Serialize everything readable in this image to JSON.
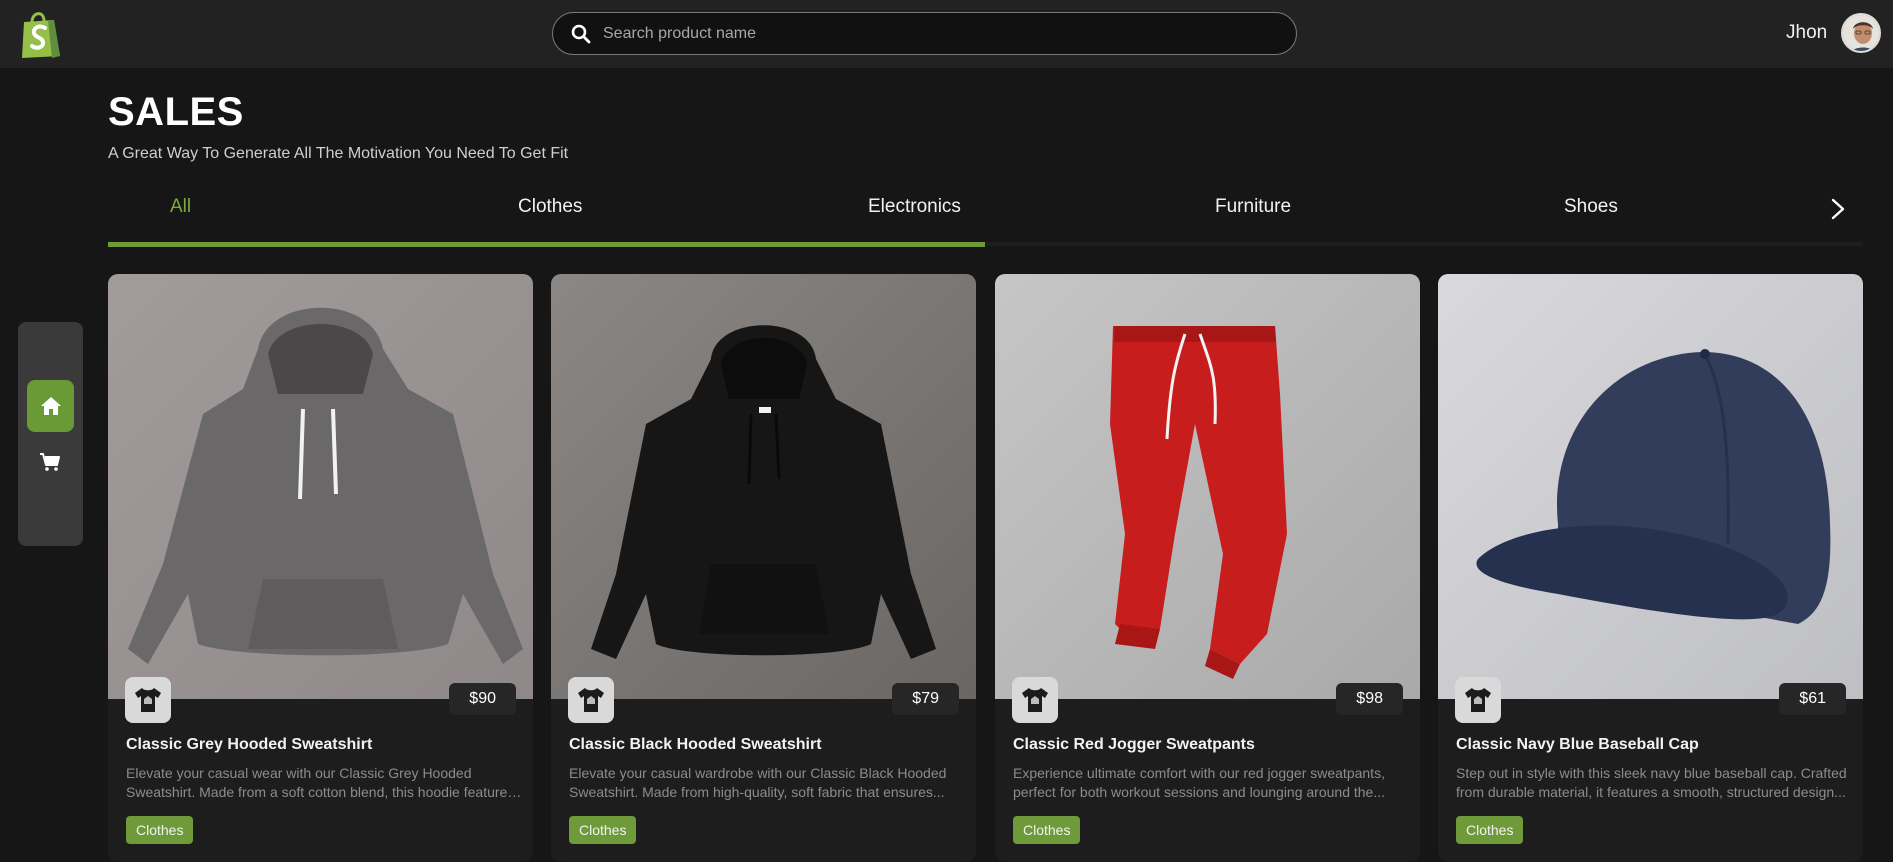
{
  "header": {
    "logo_icon": "shopping-bag-logo-icon",
    "search": {
      "placeholder": "Search product name",
      "value": ""
    },
    "user": {
      "name": "Jhon"
    }
  },
  "page": {
    "title": "SALES",
    "subtitle": "A Great Way To Generate All The Motivation You Need To Get Fit"
  },
  "tabs": [
    {
      "label": "All",
      "active": true
    },
    {
      "label": "Clothes",
      "active": false
    },
    {
      "label": "Electronics",
      "active": false
    },
    {
      "label": "Furniture",
      "active": false
    },
    {
      "label": "Shoes",
      "active": false
    }
  ],
  "sidenav": {
    "items": [
      {
        "icon": "home-icon",
        "active": true
      },
      {
        "icon": "cart-icon",
        "active": false
      }
    ]
  },
  "colors": {
    "accent": "#6e9a3a",
    "accent_text": "#7ea844",
    "background": "#161616",
    "card": "#1d1d1d"
  },
  "products": [
    {
      "title": "Classic Grey Hooded Sweatshirt",
      "price": "$90",
      "description": "Elevate your casual wear with our Classic Grey Hooded Sweatshirt. Made from a soft cotton blend, this hoodie features ...",
      "category": "Clothes"
    },
    {
      "title": "Classic Black Hooded Sweatshirt",
      "price": "$79",
      "description": "Elevate your casual wardrobe with our Classic Black Hooded Sweatshirt. Made from high-quality, soft fabric that ensures...",
      "category": "Clothes"
    },
    {
      "title": "Classic Red Jogger Sweatpants",
      "price": "$98",
      "description": "Experience ultimate comfort with our red jogger sweatpants, perfect for both workout sessions and lounging around the...",
      "category": "Clothes"
    },
    {
      "title": "Classic Navy Blue Baseball Cap",
      "price": "$61",
      "description": "Step out in style with this sleek navy blue baseball cap. Crafted from durable material, it features a smooth, structured design...",
      "category": "Clothes"
    }
  ]
}
